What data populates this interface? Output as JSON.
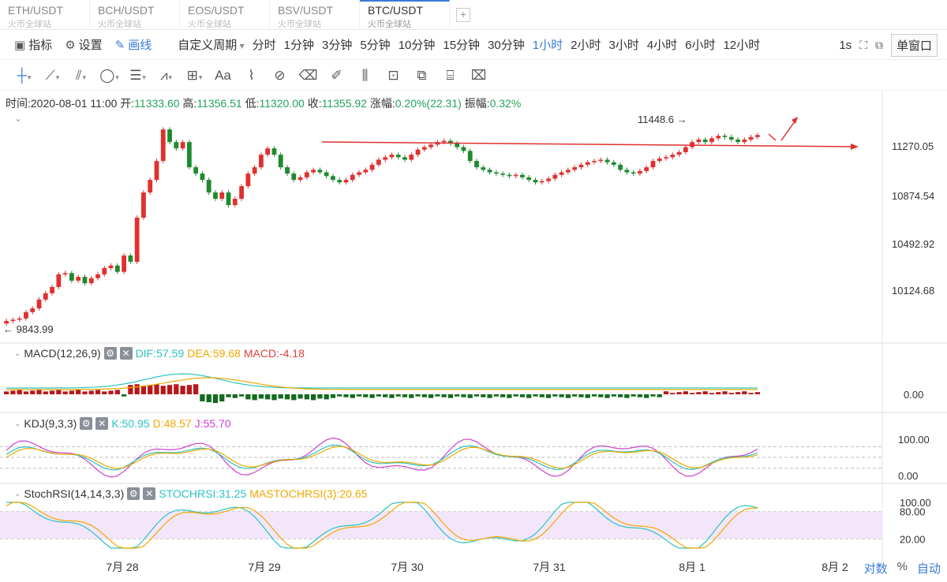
{
  "tabs": [
    {
      "pair": "ETH/USDT",
      "exchange": "火币全球站"
    },
    {
      "pair": "BCH/USDT",
      "exchange": "火币全球站"
    },
    {
      "pair": "EOS/USDT",
      "exchange": "火币全球站"
    },
    {
      "pair": "BSV/USDT",
      "exchange": "火币全球站"
    },
    {
      "pair": "BTC/USDT",
      "exchange": "火币全球站"
    }
  ],
  "active_tab": 4,
  "toolbar": {
    "indicators": "指标",
    "settings": "设置",
    "draw": "画线",
    "custom_period": "自定义周期",
    "periods": [
      "分时",
      "1分钟",
      "3分钟",
      "5分钟",
      "10分钟",
      "15分钟",
      "30分钟",
      "1小时",
      "2小时",
      "3小时",
      "4小时",
      "6小时",
      "12小时"
    ],
    "active_period": "1小时",
    "interval": "1s",
    "window_mode": "单窗口"
  },
  "drawing_tools": [
    "crosshair-icon",
    "trend-line-icon",
    "parallel-channel-icon",
    "ellipse-icon",
    "fibonacci-icon",
    "wave-icon",
    "measure-icon",
    "text-icon",
    "brush-icon",
    "magnet-icon",
    "eraser-icon",
    "pen-icon",
    "pattern-icon",
    "lock-icon",
    "copy-icon",
    "screenshot-icon",
    "delete-icon"
  ],
  "drawing_tool_label": "Aa",
  "info": {
    "time_label": "时间:",
    "time": "2020-08-01 11:00",
    "open_label": "开:",
    "open": "11333.60",
    "high_label": "高:",
    "high": "11356.51",
    "low_label": "低:",
    "low": "11320.00",
    "close_label": "收:",
    "close": "11355.92",
    "change_label": "涨幅:",
    "change": "0.20%(22.31)",
    "amplitude_label": "振幅:",
    "amplitude": "0.32%"
  },
  "price_axis": [
    "11270.05",
    "10874.54",
    "10492.92",
    "10124.68"
  ],
  "annotations": {
    "high_marker": "11448.6",
    "low_marker": "9843.99"
  },
  "macd": {
    "label": "MACD(12,26,9)",
    "dif": "DIF:57.59",
    "dea": "DEA:59.68",
    "macd": "MACD:-4.18",
    "axis": [
      "0.00"
    ]
  },
  "kdj": {
    "label": "KDJ(9,3,3)",
    "k": "K:50.95",
    "d": "D:48.57",
    "j": "J:55.70",
    "axis": [
      "100.00",
      "0.00"
    ]
  },
  "stochrsi": {
    "label": "StochRSI(14,14,3,3)",
    "stoch": "STOCHRSI:31.25",
    "mastoch": "MASTOCHRSI(3):20.65",
    "axis": [
      "100.00",
      "80.00",
      "20.00"
    ]
  },
  "date_axis": [
    "7月 28",
    "7月 29",
    "7月 30",
    "7月 31",
    "8月 1",
    "8月 2"
  ],
  "bottom": {
    "log": "对数",
    "percent": "%",
    "auto": "自动"
  },
  "colors": {
    "up": "#e0302f",
    "down": "#1e8a2f",
    "accent": "#3a7bd5",
    "dif": "#2bc3c0",
    "dea": "#f0a800",
    "j": "#d040d0"
  },
  "chart_data": {
    "type": "candlestick",
    "interval": "1小时",
    "y_ticks": [
      11270.05,
      10874.54,
      10492.92,
      10124.68
    ],
    "high": 11448.6,
    "low": 9843.99,
    "closes": [
      9880,
      9890,
      9900,
      9950,
      9980,
      10050,
      10100,
      10150,
      10250,
      10260,
      10200,
      10230,
      10180,
      10220,
      10250,
      10300,
      10320,
      10270,
      10400,
      10350,
      10700,
      10900,
      11000,
      11150,
      11400,
      11300,
      11250,
      11300,
      11100,
      11050,
      11000,
      10900,
      10850,
      10900,
      10800,
      10850,
      10950,
      11050,
      11100,
      11200,
      11250,
      11200,
      11100,
      11050,
      11000,
      11020,
      11060,
      11080,
      11060,
      11030,
      11000,
      10980,
      11000,
      11040,
      11060,
      11080,
      11120,
      11160,
      11180,
      11200,
      11180,
      11160,
      11200,
      11240,
      11260,
      11280,
      11300,
      11310,
      11290,
      11260,
      11230,
      11150,
      11100,
      11080,
      11060,
      11050,
      11040,
      11030,
      11040,
      11020,
      11000,
      10980,
      10990,
      11010,
      11040,
      11060,
      11080,
      11100,
      11120,
      11140,
      11150,
      11160,
      11140,
      11120,
      11080,
      11060,
      11050,
      11070,
      11100,
      11150,
      11170,
      11180,
      11200,
      11220,
      11260,
      11300,
      11320,
      11300,
      11330,
      11350,
      11340,
      11320,
      11300,
      11320,
      11340,
      11355.92
    ]
  }
}
